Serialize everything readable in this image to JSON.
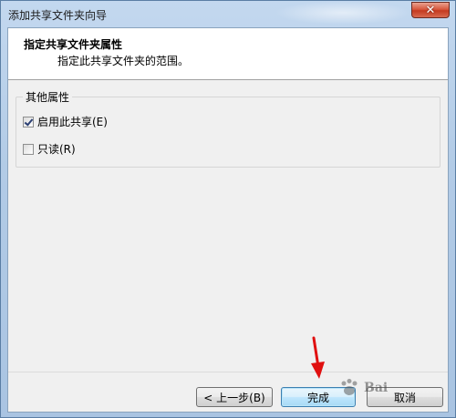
{
  "window": {
    "title": "添加共享文件夹向导"
  },
  "header": {
    "title": "指定共享文件夹属性",
    "subtitle": "指定此共享文件夹的范围。"
  },
  "group": {
    "label": "其他属性",
    "options": [
      {
        "label": "启用此共享(E)",
        "checked": true
      },
      {
        "label": "只读(R)",
        "checked": false
      }
    ]
  },
  "buttons": {
    "back": "< 上一步(B)",
    "finish": "完成",
    "cancel": "取消"
  },
  "annotation": {
    "arrow_color": "#e01010"
  },
  "watermark": {
    "text": "Bai"
  },
  "colors": {
    "title_bar": "#b2cbe6",
    "close_button": "#c43a20",
    "dialog_bg": "#f0f0f0",
    "header_bg": "#ffffff"
  }
}
